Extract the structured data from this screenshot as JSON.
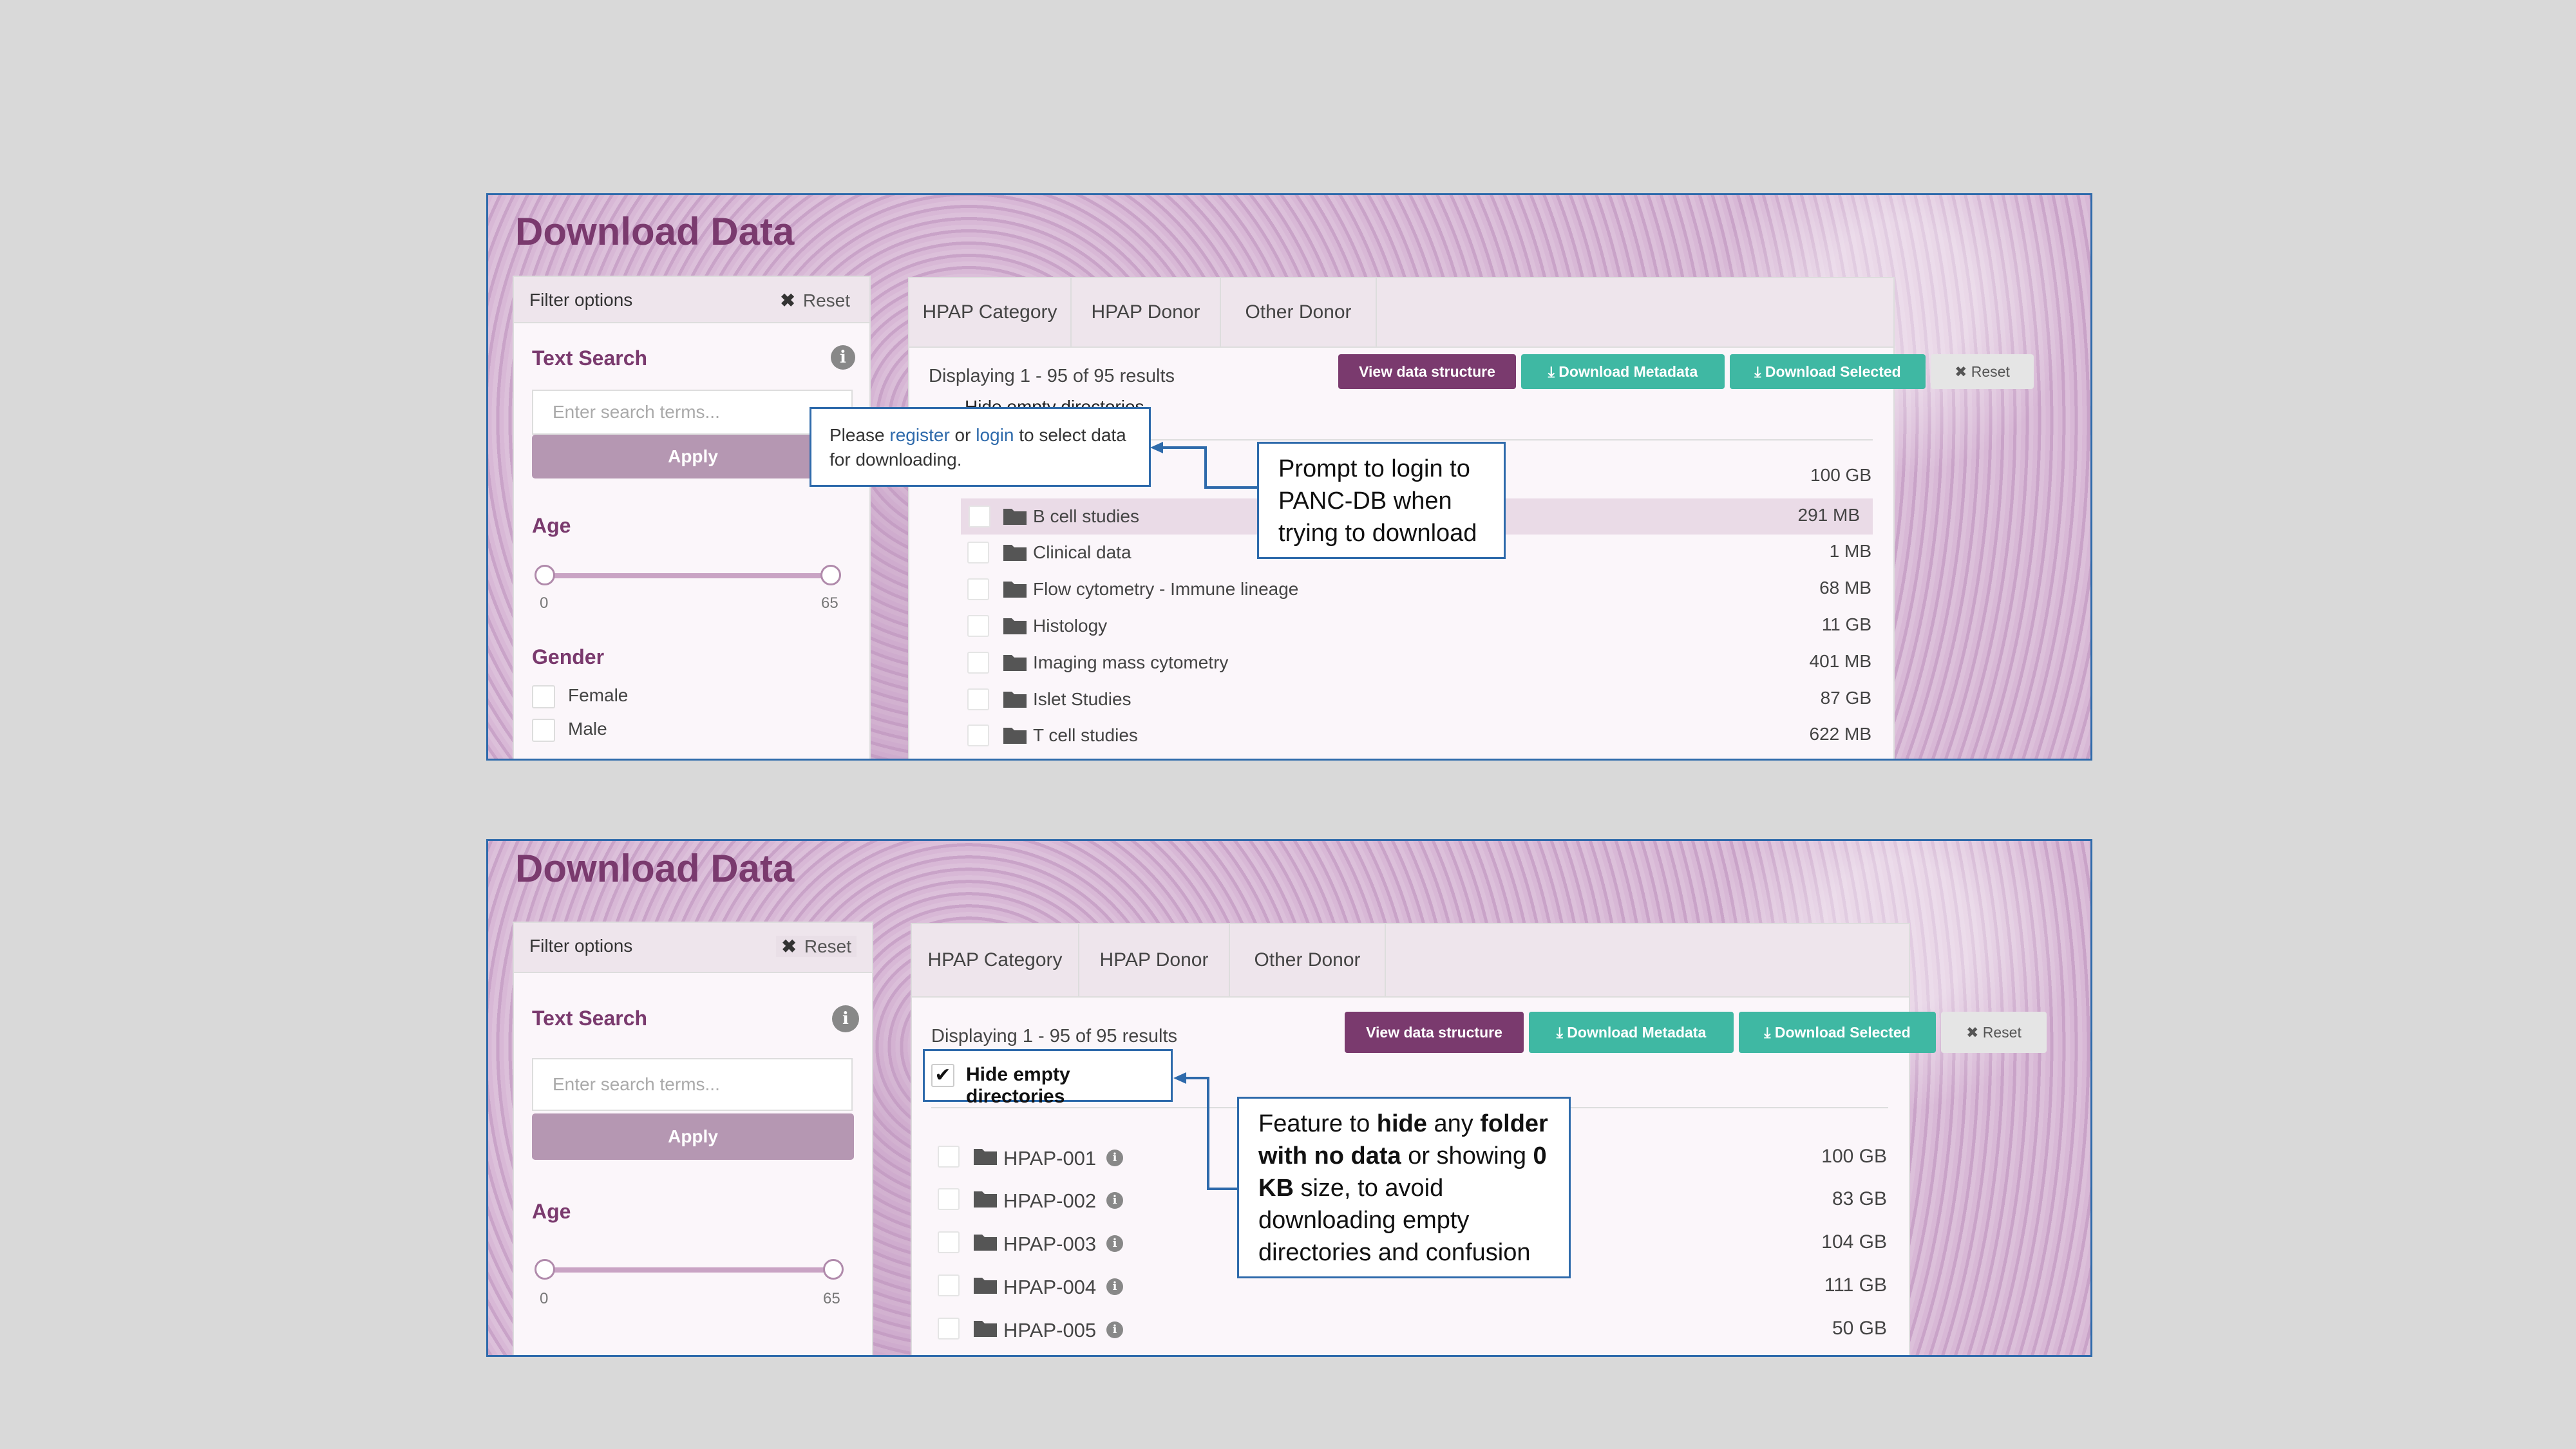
{
  "panel1": {
    "title": "Download Data",
    "filter": {
      "header": "Filter options",
      "reset": "Reset",
      "text_search": "Text Search",
      "search_placeholder": "Enter search terms...",
      "apply": "Apply",
      "age": "Age",
      "age_min": "0",
      "age_max": "65",
      "gender": "Gender",
      "female": "Female",
      "male": "Male"
    },
    "tabs": [
      "HPAP Category",
      "HPAP Donor",
      "Other Donor"
    ],
    "displaying": "Displaying 1 - 95 of 95 results",
    "hidden_partial": "Hide empty directories",
    "buttons": {
      "view": "View data structure",
      "metadata": "Download Metadata",
      "selected": "Download Selected",
      "reset": "Reset"
    },
    "top_size": "100 GB",
    "rows": [
      {
        "name": "B cell studies",
        "size": "291 MB"
      },
      {
        "name": "Clinical data",
        "size": "1 MB"
      },
      {
        "name": "Flow cytometry - Immune lineage",
        "size": "68 MB"
      },
      {
        "name": "Histology",
        "size": "11 GB"
      },
      {
        "name": "Imaging mass cytometry",
        "size": "401 MB"
      },
      {
        "name": "Islet Studies",
        "size": "87 GB"
      },
      {
        "name": "T cell studies",
        "size": "622 MB"
      }
    ],
    "popover": {
      "please": "Please ",
      "register": "register",
      "or": " or ",
      "login": "login",
      "rest": " to select data for downloading."
    },
    "callout": "Prompt to login to PANC-DB when trying to download"
  },
  "panel2": {
    "title": "Download Data",
    "filter": {
      "header": "Filter options",
      "reset": "Reset",
      "text_search": "Text Search",
      "search_placeholder": "Enter search terms...",
      "apply": "Apply",
      "age": "Age",
      "age_min": "0",
      "age_max": "65"
    },
    "tabs": [
      "HPAP Category",
      "HPAP Donor",
      "Other Donor"
    ],
    "displaying": "Displaying 1 - 95 of 95 results",
    "hide_empty": "Hide empty directories",
    "buttons": {
      "view": "View data structure",
      "metadata": "Download Metadata",
      "selected": "Download Selected",
      "reset": "Reset"
    },
    "rows": [
      {
        "name": "HPAP-001",
        "size": "100 GB"
      },
      {
        "name": "HPAP-002",
        "size": "83 GB"
      },
      {
        "name": "HPAP-003",
        "size": "104 GB"
      },
      {
        "name": "HPAP-004",
        "size": "111 GB"
      },
      {
        "name": "HPAP-005",
        "size": "50 GB"
      }
    ],
    "callout": {
      "t1": "Feature to ",
      "b1": "hide",
      "t2": " any ",
      "b2": "folder with no data",
      "t3": " or showing ",
      "b3": "0 KB",
      "t4": " size, to avoid downloading empty directories and confusion"
    }
  },
  "colors": {
    "accent_purple": "#7a3a6e",
    "teal": "#3fb8a3",
    "callout_border": "#2e6aab"
  }
}
